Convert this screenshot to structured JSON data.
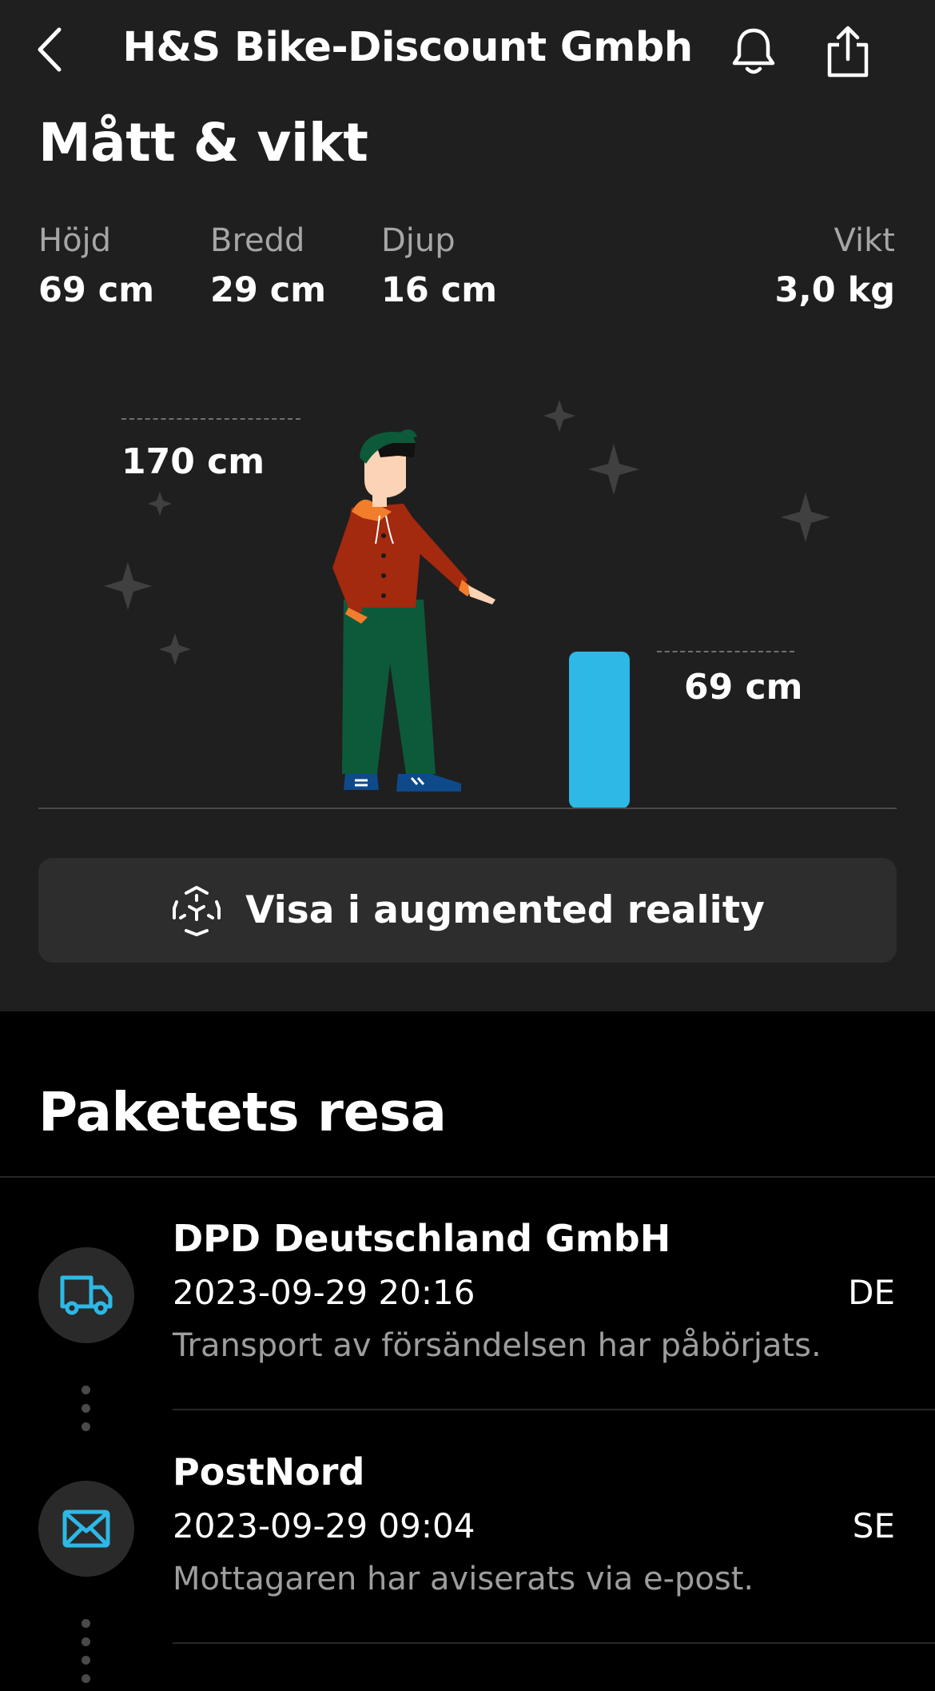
{
  "header": {
    "title": "H&S Bike-Discount Gmbh",
    "back_icon": "chevron-left-icon",
    "bell_icon": "bell-icon",
    "share_icon": "share-icon"
  },
  "dimensions": {
    "title": "Mått & vikt",
    "height": {
      "label": "Höjd",
      "value": "69 cm"
    },
    "width": {
      "label": "Bredd",
      "value": "29 cm"
    },
    "depth": {
      "label": "Djup",
      "value": "16 cm"
    },
    "weight": {
      "label": "Vikt",
      "value": "3,0 kg"
    },
    "person_label": "170 cm",
    "package_label": "69 cm",
    "package_color": "#2db8e5"
  },
  "ar_button": {
    "label": "Visa i augmented reality",
    "icon": "ar-cube-icon"
  },
  "journey": {
    "title": "Paketets resa",
    "accent_color": "#2db8e5",
    "events": [
      {
        "carrier": "DPD Deutschland GmbH",
        "time": "2023-09-29 20:16",
        "country": "DE",
        "description": "Transport av försändelsen har påbörjats.",
        "icon": "truck-icon"
      },
      {
        "carrier": "PostNord",
        "time": "2023-09-29 09:04",
        "country": "SE",
        "description": "Mottagaren har aviserats via e-post.",
        "icon": "mail-icon"
      }
    ]
  }
}
